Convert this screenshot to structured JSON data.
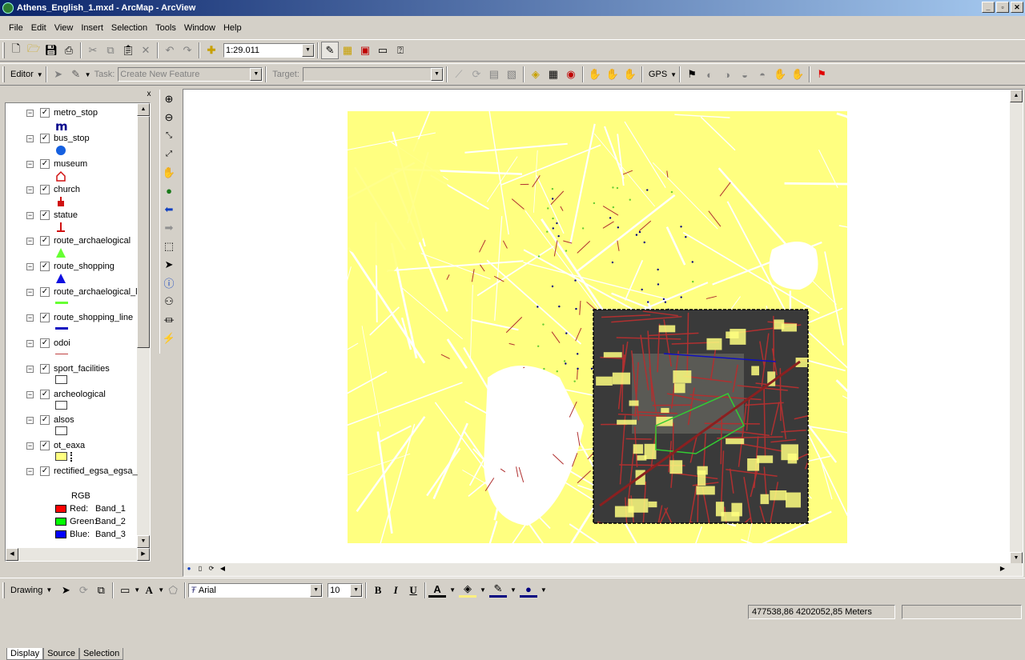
{
  "window": {
    "title": "Athens_English_1.mxd - ArcMap - ArcView",
    "minimize": "_",
    "maximize": "▫",
    "close": "✕"
  },
  "menu": [
    "File",
    "Edit",
    "View",
    "Insert",
    "Selection",
    "Tools",
    "Window",
    "Help"
  ],
  "standard_toolbar": {
    "scale": "1:29.011"
  },
  "editor_toolbar": {
    "editor_label": "Editor",
    "task_label": "Task:",
    "task_value": "Create New Feature",
    "target_label": "Target:",
    "target_value": "",
    "gps_label": "GPS"
  },
  "toc": {
    "close": "x",
    "layers": [
      {
        "name": "metro_stop",
        "symbol": "m",
        "color": "#00008b"
      },
      {
        "name": "bus_stop",
        "symbol": "circle",
        "color": "#1560e0"
      },
      {
        "name": "museum",
        "symbol": "house",
        "color": "#d01010"
      },
      {
        "name": "church",
        "symbol": "church",
        "color": "#d01010"
      },
      {
        "name": "statue",
        "symbol": "statue",
        "color": "#d01010"
      },
      {
        "name": "route_archaelogical",
        "symbol": "triangle",
        "color": "#66ff33"
      },
      {
        "name": "route_shopping",
        "symbol": "triangle",
        "color": "#1010e0"
      },
      {
        "name": "route_archaelogical_l",
        "symbol": "line",
        "color": "#66ff33"
      },
      {
        "name": "route_shopping_line",
        "symbol": "line",
        "color": "#1010c0"
      },
      {
        "name": "odoi",
        "symbol": "thinline",
        "color": "#c04040"
      },
      {
        "name": "sport_facilities",
        "symbol": "box",
        "color": "#ffffff"
      },
      {
        "name": "archeological",
        "symbol": "box",
        "color": "#ffffff"
      },
      {
        "name": "alsos",
        "symbol": "box",
        "color": "#ffffff"
      },
      {
        "name": "ot_eaxa",
        "symbol": "box",
        "color": "#ffff80"
      },
      {
        "name": "rectified_egsa_egsa_",
        "symbol": "none",
        "color": ""
      }
    ],
    "raster_legend": {
      "label": "RGB",
      "bands": [
        {
          "label": "Red:",
          "band": "Band_1",
          "color": "#ff0000"
        },
        {
          "label": "Green:",
          "band": "Band_2",
          "color": "#00ff00"
        },
        {
          "label": "Blue:",
          "band": "Band_3",
          "color": "#0000ff"
        }
      ]
    },
    "tabs": [
      "Display",
      "Source",
      "Selection"
    ]
  },
  "drawing_toolbar": {
    "drawing_label": "Drawing",
    "font": "Arial",
    "size": "10",
    "bold": "B",
    "italic": "I",
    "underline": "U",
    "text_tool": "A"
  },
  "status": {
    "coordinates": "477538,86  4202052,85 Meters"
  },
  "colors": {
    "map_fill": "#ffff80",
    "road": "#b03030",
    "titlebar": "#0a246a"
  }
}
